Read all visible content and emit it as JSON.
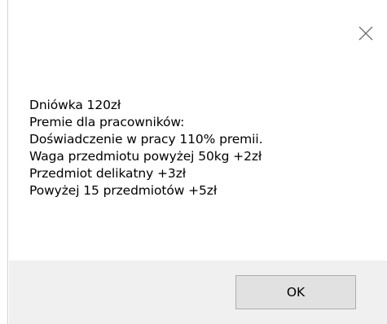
{
  "dialog": {
    "close_icon": "close-icon",
    "message_lines": [
      "Dniówka 120zł",
      "Premie dla pracowników:",
      "Doświadczenie w pracy 110% premii.",
      "Waga przedmiotu powyżej 50kg +2zł",
      "Przedmiot delikatny +3zł",
      "Powyżej 15 przedmiotów +5zł"
    ],
    "ok_label": "OK"
  },
  "colors": {
    "background": "#ffffff",
    "button_area": "#f0f0f0",
    "button_face": "#e1e1e1",
    "button_border": "#adadad",
    "close_icon": "#707070"
  }
}
